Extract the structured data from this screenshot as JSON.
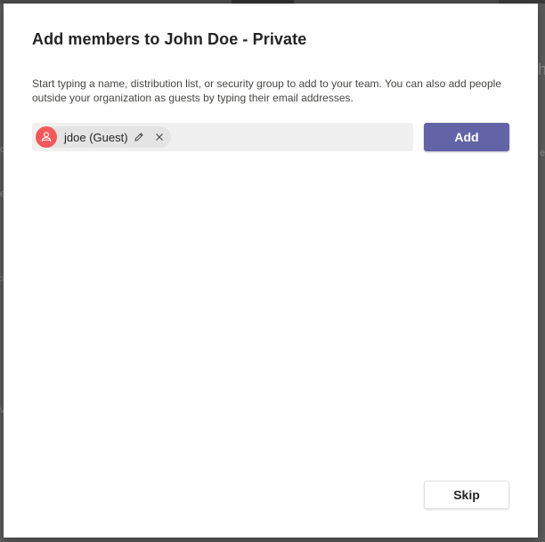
{
  "dialog": {
    "title": "Add members to John Doe - Private",
    "description": "Start typing a name, distribution list, or security group to add to your team. You can also add people outside your organization as guests by typing their email addresses."
  },
  "member_input": {
    "selected": [
      {
        "label": "jdoe (Guest)",
        "avatar_color": "#f05a5a",
        "icon": "guest-user-icon"
      }
    ]
  },
  "actions": {
    "add_label": "Add",
    "skip_label": "Skip"
  },
  "colors": {
    "accent": "#6264a7",
    "avatar": "#f05a5a"
  }
}
